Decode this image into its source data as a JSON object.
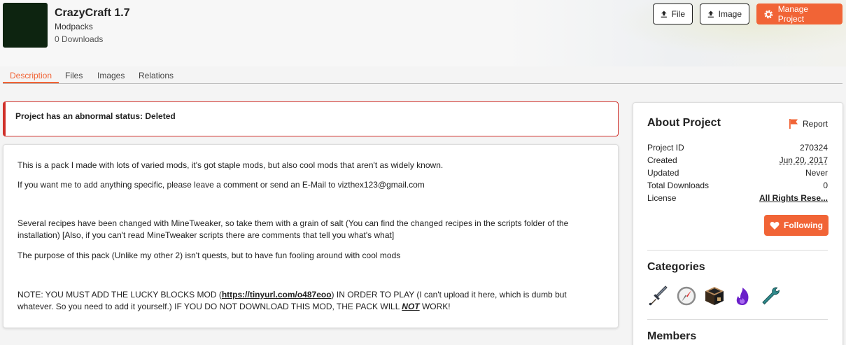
{
  "project": {
    "title": "CrazyCraft 1.7",
    "category": "Modpacks",
    "downloads": "0 Downloads"
  },
  "actions": {
    "file_label": "File",
    "image_label": "Image",
    "manage_label": "Manage Project"
  },
  "tabs": [
    {
      "label": "Description",
      "active": true
    },
    {
      "label": "Files"
    },
    {
      "label": "Images"
    },
    {
      "label": "Relations"
    }
  ],
  "alert": {
    "text": "Project has an abnormal status: Deleted"
  },
  "description": {
    "p1": "This is a pack I made with lots of varied mods, it's got staple mods, but also cool mods that aren't as widely known.",
    "p2": "If you want me to add anything specific, please leave a comment or send an E-Mail to vizthex123@gmail.com",
    "p3": "Several recipes have been changed with MineTweaker, so take them with a grain of salt (You can find the changed recipes in the scripts folder of the installation) [Also, if you can't read MineTweaker scripts there are comments that tell you what's what]",
    "p4": "The purpose of this pack (Unlike my other 2) isn't quests, but to have fun fooling around with cool mods",
    "p5_before": "NOTE: YOU MUST ADD THE LUCKY BLOCKS MOD (",
    "p5_link": "https://tinyurl.com/o487eoo",
    "p5_middle": ") IN ORDER TO PLAY (I can't upload it here, which is dumb but whatever. So you need to add it yourself.) IF YOU DO NOT DOWNLOAD THIS MOD, THE PACK WILL ",
    "p5_not": "NOT",
    "p5_after": " WORK!"
  },
  "about": {
    "heading": "About Project",
    "report_label": "Report",
    "rows": [
      {
        "label": "Project ID",
        "value": "270324"
      },
      {
        "label": "Created",
        "value": "Jun 20, 2017"
      },
      {
        "label": "Updated",
        "value": "Never"
      },
      {
        "label": "Total Downloads",
        "value": "0"
      },
      {
        "label": "License",
        "value": "All Rights Rese..."
      }
    ],
    "following_label": "Following"
  },
  "categories": {
    "heading": "Categories",
    "icons": [
      "sword-icon",
      "compass-icon",
      "crafting-block-icon",
      "magic-flame-icon",
      "wrench-icon"
    ]
  },
  "members": {
    "heading": "Members"
  },
  "colors": {
    "accent": "#f16436",
    "alert": "#d0302a"
  }
}
